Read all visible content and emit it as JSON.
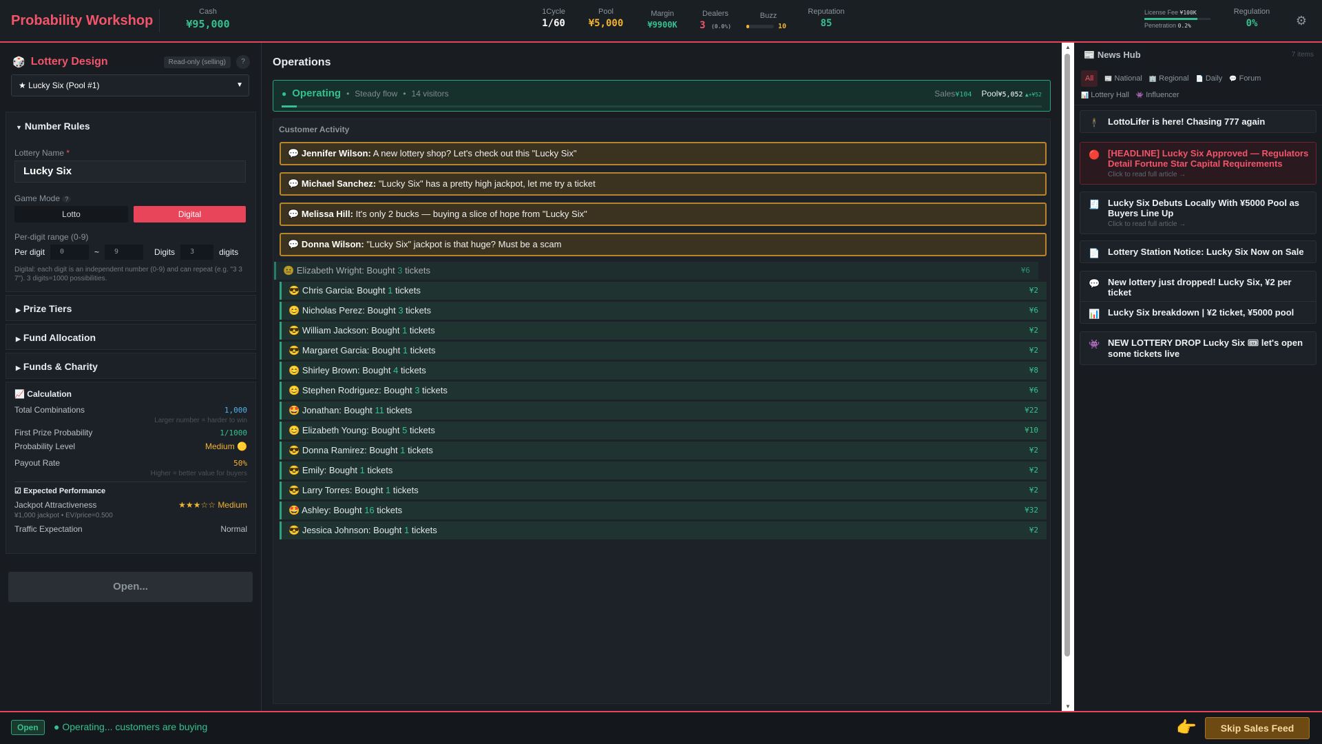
{
  "app": {
    "title": "Probability Workshop"
  },
  "stats": {
    "cash_label": "Cash",
    "cash": "¥95,000",
    "cycle_label": "1Cycle",
    "cycle": "1/60",
    "pool_label": "Pool",
    "pool": "¥5,000",
    "margin_label": "Margin",
    "margin": "¥9900K",
    "dealers_label": "Dealers",
    "dealers": "3",
    "dealers_sub": "(0.0%)",
    "buzz_label": "Buzz",
    "buzz": "10",
    "buzz_fill": 0.1,
    "rep_label": "Reputation",
    "rep": "85",
    "license_label": "License Fee",
    "license": "¥100K",
    "penetration_label": "Penetration",
    "penetration": "0.2%",
    "penetration_fill": 0.8,
    "reg_label": "Regulation",
    "reg": "0%"
  },
  "left": {
    "title": "Lottery Design",
    "readonly": "Read-only (selling)",
    "help": "?",
    "select": "★ Lucky Six (Pool #1)",
    "number_rules": "Number Rules",
    "name_label": "Lottery Name",
    "required": "*",
    "name_value": "Lucky Six",
    "mode_label": "Game Mode",
    "mode_help": "?",
    "mode_lotto": "Lotto",
    "mode_digital": "Digital",
    "range_label": "Per-digit range (0-9)",
    "per_digit": "Per digit",
    "min": "0",
    "tilde": "~",
    "max": "9",
    "digits_label": "Digits",
    "digits": "3",
    "digits_unit": "digits",
    "hint": "Digital: each digit is an independent number (0-9) and can repeat (e.g. \"3 3 7\"). 3 digits=1000 possibilities.",
    "prize_tiers": "Prize Tiers",
    "fund_alloc": "Fund Allocation",
    "funds_charity": "Funds & Charity",
    "calc_title": "Calculation",
    "total_comb_label": "Total Combinations",
    "total_comb": "1,000",
    "total_hint": "Larger number = harder to win",
    "first_prob_label": "First Prize Probability",
    "first_prob": "1/1000",
    "prob_level_label": "Probability Level",
    "prob_level": "Medium",
    "payout_label": "Payout Rate",
    "payout": "50%",
    "payout_hint": "Higher = better value for buyers",
    "exp_title": "Expected Performance",
    "jackpot_label": "Jackpot Attractiveness",
    "jackpot_stars": "★★★☆☆",
    "jackpot_level": "Medium",
    "jackpot_sub1": "¥1,000 jackpot",
    "jackpot_sub2": "EV/price=0.500",
    "traffic_label": "Traffic Expectation",
    "traffic": "Normal",
    "open_btn": "Open..."
  },
  "ops": {
    "title": "Operations",
    "status": "Operating",
    "flow": "Steady flow",
    "visitors": "14 visitors",
    "sales_label": "Sales",
    "sales": "¥104",
    "pool_label": "Pool",
    "pool": "¥5,052",
    "pool_delta": "▲+¥52",
    "progress": 0.02,
    "activity_title": "Customer Activity",
    "chats": [
      {
        "name": "Jennifer Wilson:",
        "text": "A new lottery shop? Let's check out this \"Lucky Six\""
      },
      {
        "name": "Michael Sanchez:",
        "text": "\"Lucky Six\" has a pretty high jackpot, let me try a ticket"
      },
      {
        "name": "Melissa Hill:",
        "text": "It's only 2 bucks — buying a slice of hope from \"Lucky Six\""
      },
      {
        "name": "Donna Wilson:",
        "text": "\"Lucky Six\" jackpot is that huge? Must be a scam"
      }
    ],
    "purchases": [
      {
        "name": "Elizabeth Wright:",
        "n": "3",
        "amt": "¥6"
      },
      {
        "name": "Chris Garcia:",
        "n": "1",
        "amt": "¥2"
      },
      {
        "name": "Nicholas Perez:",
        "n": "3",
        "amt": "¥6"
      },
      {
        "name": "William Jackson:",
        "n": "1",
        "amt": "¥2"
      },
      {
        "name": "Margaret Garcia:",
        "n": "1",
        "amt": "¥2"
      },
      {
        "name": "Shirley Brown:",
        "n": "4",
        "amt": "¥8"
      },
      {
        "name": "Stephen Rodriguez:",
        "n": "3",
        "amt": "¥6"
      },
      {
        "name": "Jonathan:",
        "n": "11",
        "amt": "¥22"
      },
      {
        "name": "Elizabeth Young:",
        "n": "5",
        "amt": "¥10"
      },
      {
        "name": "Donna Ramirez:",
        "n": "1",
        "amt": "¥2"
      },
      {
        "name": "Emily:",
        "n": "1",
        "amt": "¥2"
      },
      {
        "name": "Larry Torres:",
        "n": "1",
        "amt": "¥2"
      },
      {
        "name": "Ashley:",
        "n": "16",
        "amt": "¥32"
      },
      {
        "name": "Jessica Johnson:",
        "n": "1",
        "amt": "¥2"
      }
    ],
    "bought": "Bought",
    "tickets": "tickets"
  },
  "news": {
    "title": "News Hub",
    "count": "7 items",
    "tabs": [
      "All",
      "National",
      "Regional",
      "Daily",
      "Forum",
      "Lottery Hall",
      "Influencer"
    ],
    "items": [
      {
        "text": "LottoLifer is here! Chasing 777 again",
        "sub": ""
      },
      {
        "text": "[HEADLINE] Lucky Six Approved — Regulators Detail Fortune Star Capital Requirements",
        "sub": "Click to read full article →"
      },
      {
        "text": "Lucky Six Debuts Locally With ¥5000 Pool as Buyers Line Up",
        "sub": "Click to read full article →"
      },
      {
        "text": "Lottery Station Notice: Lucky Six Now on Sale",
        "sub": ""
      },
      {
        "text": "New lottery just dropped! Lucky Six, ¥2 per ticket",
        "sub": ""
      },
      {
        "text": "Lucky Six breakdown | ¥2 ticket, ¥5000 pool",
        "sub": ""
      },
      {
        "text": "NEW LOTTERY DROP Lucky Six 🎟 let's open some tickets live",
        "sub": ""
      }
    ]
  },
  "bottom": {
    "badge": "Open",
    "status": "Operating... customers are buying",
    "skip": "Skip Sales Feed"
  },
  "colors": {
    "accent": "#f2546a",
    "green": "#36c08f",
    "gold": "#f2b233"
  }
}
